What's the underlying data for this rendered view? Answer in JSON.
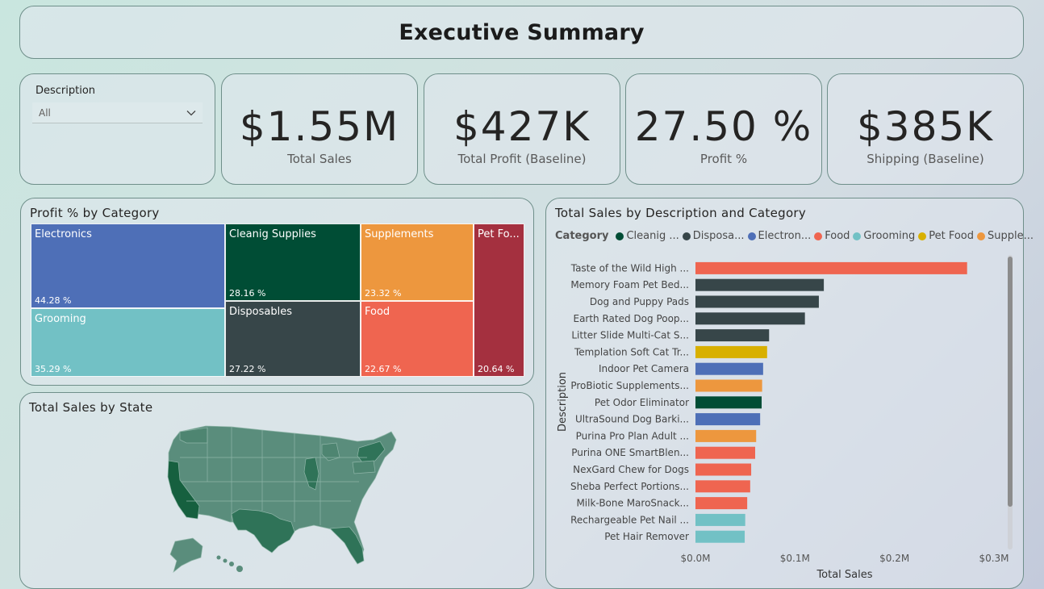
{
  "title": "Executive Summary",
  "slicer": {
    "label": "Description",
    "value": "All"
  },
  "kpis": [
    {
      "value": "$1.55M",
      "label": "Total Sales"
    },
    {
      "value": "$427K",
      "label": "Total Profit (Baseline)"
    },
    {
      "value": "27.50 %",
      "label": "Profit %"
    },
    {
      "value": "$385K",
      "label": "Shipping (Baseline)"
    }
  ],
  "colors": {
    "electronics": "#4E6FB7",
    "cleaning": "#004D35",
    "supplements": "#ED973E",
    "petfood": "#A4303F",
    "grooming": "#72C1C5",
    "disposables": "#374649",
    "food": "#EF6550",
    "petfood_legend": "#D8B000",
    "map_base": "#5a8d7c",
    "map_dark": "#2f7358",
    "map_darkest": "#16603f"
  },
  "treemap": {
    "title": "Profit % by Category",
    "tiles": [
      {
        "name": "Electronics",
        "value": "44.28 %"
      },
      {
        "name": "Grooming",
        "value": "35.29 %"
      },
      {
        "name": "Cleanig Supplies",
        "value": "28.16 %"
      },
      {
        "name": "Disposables",
        "value": "27.22 %"
      },
      {
        "name": "Supplements",
        "value": "23.32 %"
      },
      {
        "name": "Food",
        "value": "22.67 %"
      },
      {
        "name": "Pet Fo...",
        "value": "20.64 %"
      }
    ]
  },
  "map": {
    "title": "Total Sales by State"
  },
  "bar_chart": {
    "title": "Total Sales by Description and Category"
  },
  "chart_data": {
    "type": "bar",
    "orientation": "horizontal",
    "title": "Total Sales by Description and Category",
    "xlabel": "Total Sales",
    "ylabel": "Description",
    "xlim": [
      0,
      300000
    ],
    "xticks": [
      "$0.0M",
      "$0.1M",
      "$0.2M",
      "$0.3M"
    ],
    "legend_title": "Category",
    "legend": [
      {
        "label": "Cleanig ...",
        "color": "#004D35"
      },
      {
        "label": "Disposa...",
        "color": "#374649"
      },
      {
        "label": "Electron...",
        "color": "#4E6FB7"
      },
      {
        "label": "Food",
        "color": "#EF6550"
      },
      {
        "label": "Grooming",
        "color": "#72C1C5"
      },
      {
        "label": "Pet Food",
        "color": "#D8B000"
      },
      {
        "label": "Supple...",
        "color": "#ED973E"
      }
    ],
    "bars": [
      {
        "label": "Taste of the Wild High ...",
        "value": 273000,
        "color": "#EF6550"
      },
      {
        "label": "Memory Foam Pet Bed...",
        "value": 129000,
        "color": "#374649"
      },
      {
        "label": "Dog and Puppy Pads",
        "value": 124000,
        "color": "#374649"
      },
      {
        "label": "Earth Rated Dog Poop...",
        "value": 110000,
        "color": "#374649"
      },
      {
        "label": "Litter Slide Multi-Cat S...",
        "value": 74000,
        "color": "#374649"
      },
      {
        "label": "Templation Soft Cat Tr...",
        "value": 72000,
        "color": "#D8B000"
      },
      {
        "label": "Indoor Pet Camera",
        "value": 68000,
        "color": "#4E6FB7"
      },
      {
        "label": "ProBiotic Supplements...",
        "value": 67000,
        "color": "#ED973E"
      },
      {
        "label": "Pet Odor Eliminator",
        "value": 66500,
        "color": "#004D35"
      },
      {
        "label": "UltraSound Dog Barki...",
        "value": 65000,
        "color": "#4E6FB7"
      },
      {
        "label": "Purina Pro Plan Adult ...",
        "value": 61000,
        "color": "#ED973E"
      },
      {
        "label": "Purina ONE SmartBlen...",
        "value": 60000,
        "color": "#EF6550"
      },
      {
        "label": "NexGard Chew for Dogs",
        "value": 56000,
        "color": "#EF6550"
      },
      {
        "label": "Sheba Perfect Portions...",
        "value": 55000,
        "color": "#EF6550"
      },
      {
        "label": "Milk-Bone MaroSnack...",
        "value": 52000,
        "color": "#EF6550"
      },
      {
        "label": "Rechargeable Pet Nail ...",
        "value": 50000,
        "color": "#72C1C5"
      },
      {
        "label": "Pet Hair Remover",
        "value": 49500,
        "color": "#72C1C5"
      }
    ]
  }
}
